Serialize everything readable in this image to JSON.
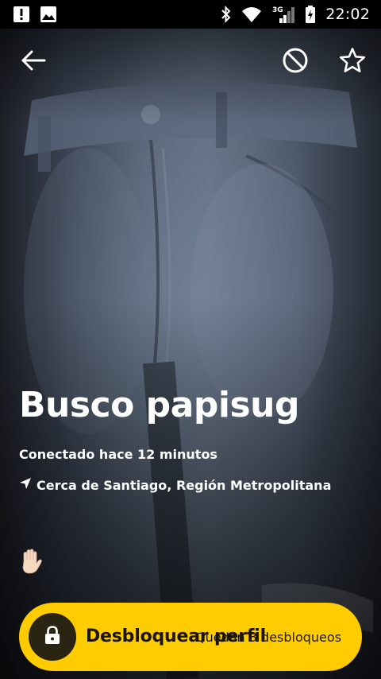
{
  "status_bar": {
    "time": "22:02",
    "network": "3G",
    "icons": [
      "alert-icon",
      "image-icon",
      "bluetooth-icon",
      "wifi-icon",
      "signal-icon",
      "battery-charging-icon"
    ]
  },
  "toolbar": {
    "back_icon": "arrow-back-icon",
    "block_icon": "block-icon",
    "favorite_icon": "star-outline-icon"
  },
  "profile": {
    "name": "Busco papisug",
    "last_seen": "Conectado hace 12 minutos",
    "location": "Cerca de Santiago, Región Metropolitana",
    "wave_icon": "wave-hand-icon"
  },
  "unlock": {
    "label": "Desbloquear perfil",
    "remaining": "Quedan 3 desbloqueos",
    "icon": "lock-icon",
    "accent_color": "#ffcc00"
  }
}
